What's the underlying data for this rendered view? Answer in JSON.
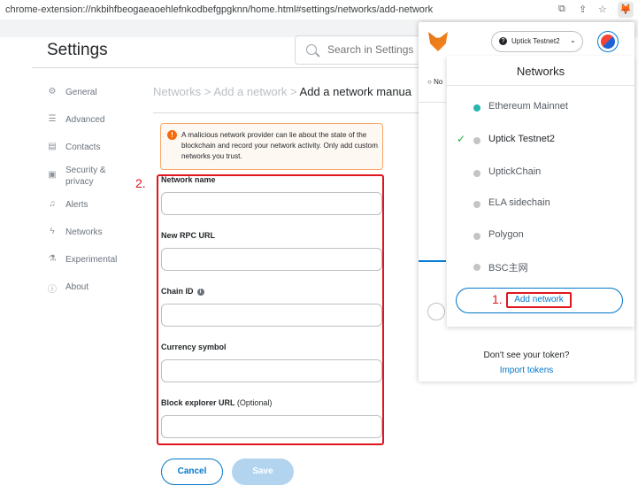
{
  "browser": {
    "url": "chrome-extension://nkbihfbeogaeaoehlefnkodbefgpgknn/home.html#settings/networks/add-network"
  },
  "settings": {
    "title": "Settings",
    "search_placeholder": "Search in Settings",
    "nav": [
      {
        "label": "General",
        "icon": "gear-icon"
      },
      {
        "label": "Advanced",
        "icon": "sliders-icon"
      },
      {
        "label": "Contacts",
        "icon": "contacts-book-icon"
      },
      {
        "label": "Security & privacy",
        "icon": "lock-icon"
      },
      {
        "label": "Alerts",
        "icon": "bell-icon"
      },
      {
        "label": "Networks",
        "icon": "plug-icon"
      },
      {
        "label": "Experimental",
        "icon": "flask-icon"
      },
      {
        "label": "About",
        "icon": "info-icon"
      }
    ],
    "breadcrumb": {
      "networks": "Networks",
      "sep": ">",
      "add_network": "Add a network",
      "current": "Add a network manua"
    },
    "warning_text": "A malicious network provider can lie about the state of the blockchain and record your network activity. Only add custom networks you trust.",
    "form": {
      "network_name_label": "Network name",
      "rpc_url_label": "New RPC URL",
      "chain_id_label": "Chain ID",
      "currency_symbol_label": "Currency symbol",
      "block_explorer_label": "Block explorer URL",
      "optional": "(Optional)",
      "network_name_value": "",
      "rpc_url_value": "",
      "chain_id_value": "",
      "currency_symbol_value": "",
      "block_explorer_value": ""
    },
    "buttons": {
      "cancel": "Cancel",
      "save": "Save"
    },
    "annotation_step2": "2."
  },
  "metamask": {
    "current_network": "Uptick Testnet2",
    "bg_fragment": "No",
    "networks_title": "Networks",
    "networks": [
      {
        "label": "Ethereum Mainnet",
        "dot_color": "#29b6af",
        "selected": false
      },
      {
        "label": "Uptick Testnet2",
        "dot_color": "#c4c4c4",
        "selected": true
      },
      {
        "label": "UptickChain",
        "dot_color": "#c4c4c4",
        "selected": false
      },
      {
        "label": "ELA sidechain",
        "dot_color": "#c4c4c4",
        "selected": false
      },
      {
        "label": "Polygon",
        "dot_color": "#c4c4c4",
        "selected": false
      },
      {
        "label": "BSC主网",
        "dot_color": "#c4c4c4",
        "selected": false
      }
    ],
    "add_network": "Add network",
    "annotation_step1": "1.",
    "tokens_question": "Don't see your token?",
    "import_tokens": "Import tokens"
  },
  "colors": {
    "accent_blue": "#0376c9",
    "annotation_red": "#e0161e",
    "check_green": "#28a745",
    "warning_orange": "#f66a0a"
  }
}
